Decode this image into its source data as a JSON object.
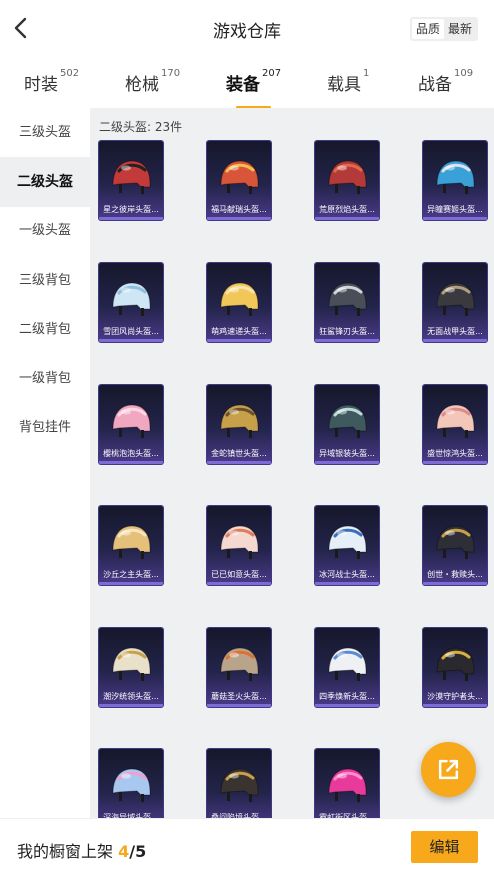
{
  "header": {
    "title": "游戏仓库",
    "sort": [
      "品质",
      "最新"
    ],
    "sort_active": 0
  },
  "tabs": [
    {
      "label": "时装",
      "count": "502"
    },
    {
      "label": "枪械",
      "count": "170"
    },
    {
      "label": "装备",
      "count": "207"
    },
    {
      "label": "载具",
      "count": "1"
    },
    {
      "label": "战备",
      "count": "109"
    }
  ],
  "active_tab": 2,
  "sidebar": [
    {
      "label": "三级头盔"
    },
    {
      "label": "二级头盔"
    },
    {
      "label": "一级头盔"
    },
    {
      "label": "三级背包"
    },
    {
      "label": "二级背包"
    },
    {
      "label": "一级背包"
    },
    {
      "label": "背包挂件"
    }
  ],
  "sidebar_active": 1,
  "section": {
    "title": "二级头盔: 23件"
  },
  "items": [
    {
      "name": "星之彼岸头盔...",
      "color": "#c23a3a",
      "accent": "#222222"
    },
    {
      "name": "福马献瑞头盔...",
      "color": "#d9553a",
      "accent": "#f0c04a"
    },
    {
      "name": "荒原烈焰头盔...",
      "color": "#b43a3a",
      "accent": "#e06a4a"
    },
    {
      "name": "异瞳赛姬头盔...",
      "color": "#3aa0d8",
      "accent": "#e0e0f0"
    },
    {
      "name": "雪团风尚头盔...",
      "color": "#cfe6f5",
      "accent": "#8fc0e0"
    },
    {
      "name": "萌鸡速递头盔...",
      "color": "#f2c75a",
      "accent": "#f5e3b0"
    },
    {
      "name": "狂鲨锋刃头盔...",
      "color": "#4a4e58",
      "accent": "#d0d4dc"
    },
    {
      "name": "无面战甲头盔...",
      "color": "#3a3a3e",
      "accent": "#b0a080"
    },
    {
      "name": "樱桃泡泡头盔...",
      "color": "#f2a7c0",
      "accent": "#ffd6e4"
    },
    {
      "name": "金蛇镇世头盔...",
      "color": "#c9a04a",
      "accent": "#6a5030"
    },
    {
      "name": "异域银装头盔...",
      "color": "#3e5a5e",
      "accent": "#c0d8d8"
    },
    {
      "name": "盛世惊鸿头盔...",
      "color": "#f2c6b8",
      "accent": "#e08a8a"
    },
    {
      "name": "沙丘之主头盔...",
      "color": "#e5c07a",
      "accent": "#f5e6c0"
    },
    {
      "name": "已已如意头盔...",
      "color": "#f5d8d0",
      "accent": "#e07a5a"
    },
    {
      "name": "冰河战士头盔...",
      "color": "#e6eef8",
      "accent": "#3a70c0"
    },
    {
      "name": "创世・救赎头...",
      "color": "#2e2f36",
      "accent": "#c9a04a"
    },
    {
      "name": "潮汐统领头盔...",
      "color": "#e8e0c8",
      "accent": "#c9a04a"
    },
    {
      "name": "蘑菇圣火头盔...",
      "color": "#b8a48a",
      "accent": "#e07030"
    },
    {
      "name": "四季焕新头盔...",
      "color": "#eef0f4",
      "accent": "#5a8ad0"
    },
    {
      "name": "沙漠守护者头...",
      "color": "#2a2a2e",
      "accent": "#d8b040"
    },
    {
      "name": "深海异域头盔...",
      "color": "#a8c8f0",
      "accent": "#f0a0d0"
    },
    {
      "name": "桑问陷境头盔...",
      "color": "#3a3430",
      "accent": "#c9a04a"
    },
    {
      "name": "霓虹街区头盔...",
      "color": "#e83a9a",
      "accent": "#ff8ad0"
    }
  ],
  "shelf": {
    "label": "我的橱窗上架",
    "count": "4",
    "separator": "/",
    "max": "5"
  },
  "edit_label": "编辑",
  "colors": {
    "accent": "#f7a81b",
    "content_bg": "#eef0f2",
    "card_top": "#16172b",
    "card_bottom": "#4b3a8a"
  }
}
